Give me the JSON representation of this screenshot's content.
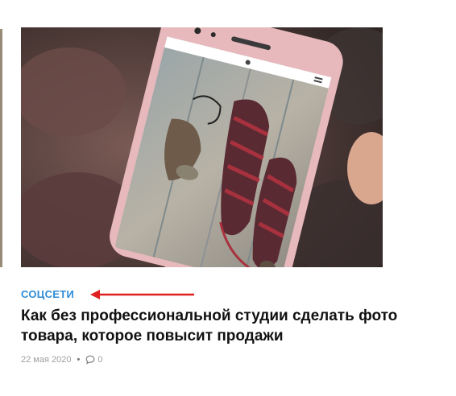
{
  "colors": {
    "accent": "#2f8bd6",
    "arrow": "#e02020",
    "title": "#111111",
    "meta": "#a0a0a0"
  },
  "post": {
    "image_description_icon": "post-photo",
    "category": "СОЦСЕТИ",
    "title": "Как без профессиональной студии сделать фото товара, которое повысит продажи",
    "date": "22 мая 2020",
    "separator": "•",
    "comments_count": "0"
  }
}
